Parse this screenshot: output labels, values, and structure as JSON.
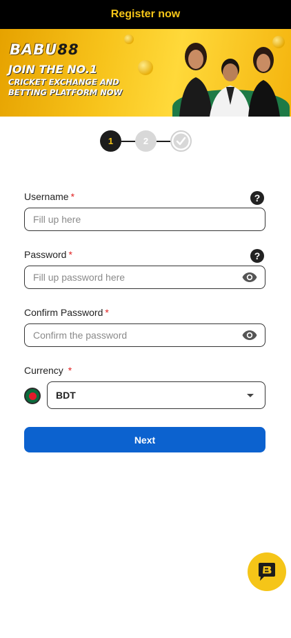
{
  "header": {
    "title": "Register now"
  },
  "banner": {
    "logo_text": "BABU",
    "logo_number": "88",
    "headline": "JOIN THE NO.1",
    "subline": "CRICKET EXCHANGE AND BETTING PLATFORM NOW"
  },
  "stepper": {
    "steps": [
      {
        "label": "1",
        "state": "active"
      },
      {
        "label": "2",
        "state": "inactive"
      },
      {
        "label": "",
        "icon": "check-circle-icon",
        "state": "inactive"
      }
    ]
  },
  "form": {
    "username": {
      "label": "Username",
      "required_mark": "*",
      "placeholder": "Fill up here",
      "value": ""
    },
    "password": {
      "label": "Password",
      "required_mark": "*",
      "placeholder": "Fill up password here",
      "value": ""
    },
    "confirm_password": {
      "label": "Confirm Password",
      "required_mark": "*",
      "placeholder": "Confirm the password",
      "value": ""
    },
    "currency": {
      "label": "Currency",
      "required_mark": "*",
      "selected": "BDT",
      "flag_icon": "bangladesh-flag-icon"
    },
    "help_glyph": "?",
    "next_label": "Next"
  },
  "colors": {
    "accent_yellow": "#f5c518",
    "primary_blue": "#0c62cf",
    "required_red": "#e02020",
    "header_bg": "#000000"
  }
}
